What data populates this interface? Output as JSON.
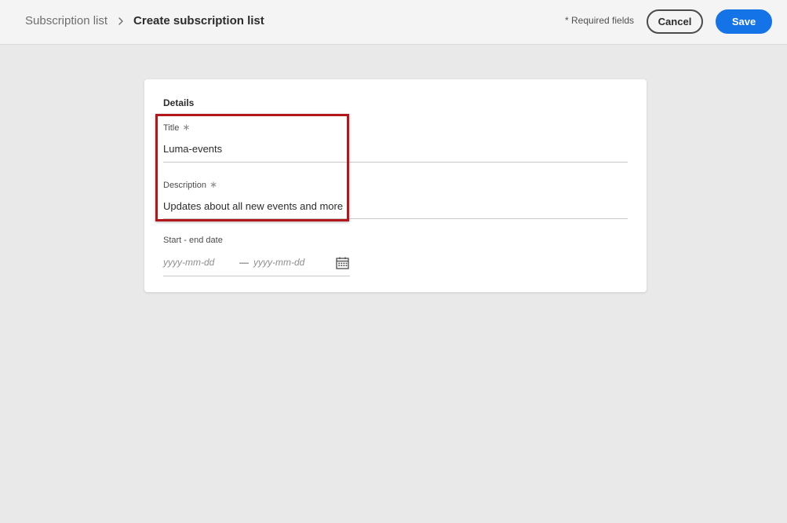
{
  "header": {
    "breadcrumb_parent": "Subscription list",
    "breadcrumb_current": "Create subscription list",
    "required_note": "* Required fields",
    "cancel_label": "Cancel",
    "save_label": "Save"
  },
  "details": {
    "heading": "Details",
    "title_label": "Title",
    "title_value": "Luma-events",
    "description_label": "Description",
    "description_value": "Updates about all new events and more",
    "required_marker": "∗",
    "date_label": "Start - end date",
    "start_placeholder": "yyyy-mm-dd",
    "end_placeholder": "yyyy-mm-dd",
    "date_separator": "—"
  },
  "colors": {
    "accent": "#1473e6",
    "highlight": "#b3171c",
    "background": "#e9e9e9"
  },
  "icons": {
    "breadcrumb_separator": "chevron-right-icon",
    "date_picker": "calendar-icon"
  }
}
